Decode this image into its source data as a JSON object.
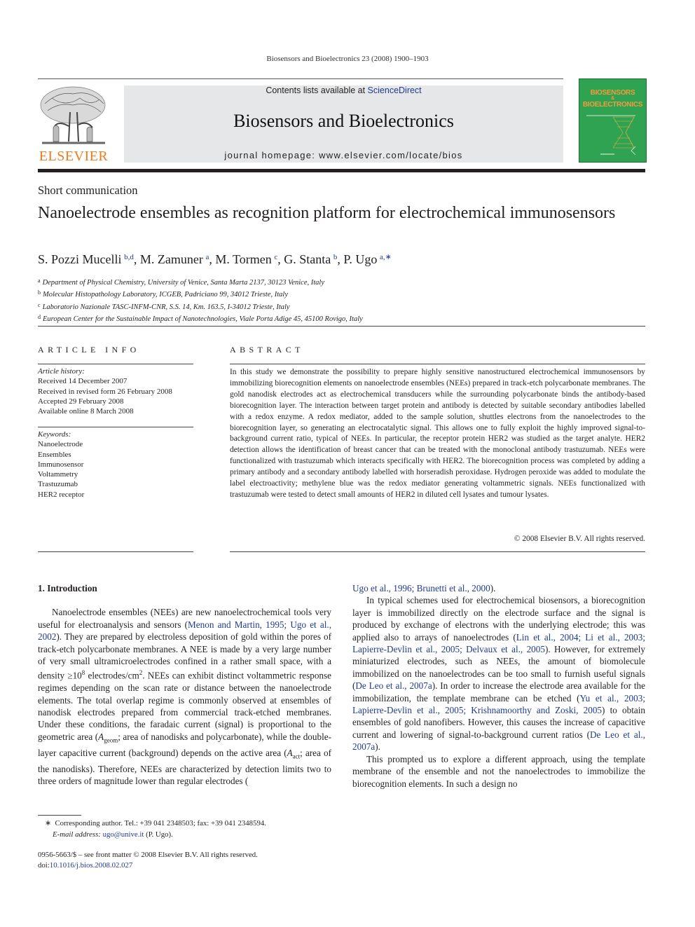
{
  "running_head": "Biosensors and Bioelectronics 23 (2008) 1900–1903",
  "masthead": {
    "contents_prefix": "Contents lists available at ",
    "contents_link": "ScienceDirect",
    "journal_name": "Biosensors and Bioelectronics",
    "homepage_label": "journal homepage: www.elsevier.com/locate/bios",
    "publisher_logo_text": "ELSEVIER",
    "cover_title_line1": "BIOSENSORS",
    "cover_title_amp": "&",
    "cover_title_line2": "BIOELECTRONICS",
    "colors": {
      "masthead_bg": "#e6e7e9",
      "elsevier_orange": "#f07a1d",
      "cover_green": "#2fa352",
      "link_blue": "#1f3b8f"
    }
  },
  "article": {
    "type": "Short communication",
    "title": "Nanoelectrode ensembles as recognition platform for electrochemical immunosensors",
    "authors": [
      {
        "name": "S. Pozzi Mucelli",
        "sup": "b,d",
        "sep": ", "
      },
      {
        "name": "M. Zamuner",
        "sup": "a",
        "sep": ", "
      },
      {
        "name": "M. Tormen",
        "sup": "c",
        "sep": ", "
      },
      {
        "name": "G. Stanta",
        "sup": "b",
        "sep": ", "
      },
      {
        "name": "P. Ugo",
        "sup": "a,∗",
        "sep": ""
      }
    ],
    "affiliations": [
      {
        "key": "a",
        "text": "Department of Physical Chemistry, University of Venice, Santa Marta 2137, 30123 Venice, Italy"
      },
      {
        "key": "b",
        "text": "Molecular Histopathology Laboratory, ICGEB, Padriciano 99, 34012 Trieste, Italy"
      },
      {
        "key": "c",
        "text": "Laboratorio Nazionale TASC-INFM-CNR, S.S. 14, Km. 163.5, I-34012 Trieste, Italy"
      },
      {
        "key": "d",
        "text": "European Center for the Sustainable Impact of Nanotechnologies, Viale Porta Adige 45, 45100 Rovigo, Italy"
      }
    ]
  },
  "article_info": {
    "heading": "ARTICLE INFO",
    "history_label": "Article history:",
    "history": [
      "Received 14 December 2007",
      "Received in revised form 26 February 2008",
      "Accepted 29 February 2008",
      "Available online 8 March 2008"
    ],
    "keywords_label": "Keywords:",
    "keywords": [
      "Nanoelectrode",
      "Ensembles",
      "Immunosensor",
      "Voltammetry",
      "Trastuzumab",
      "HER2 receptor"
    ]
  },
  "abstract": {
    "heading": "ABSTRACT",
    "text": "In this study we demonstrate the possibility to prepare highly sensitive nanostructured electrochemical immunosensors by immobilizing biorecognition elements on nanoelectrode ensembles (NEEs) prepared in track-etch polycarbonate membranes. The gold nanodisk electrodes act as electrochemical transducers while the surrounding polycarbonate binds the antibody-based biorecognition layer. The interaction between target protein and antibody is detected by suitable secondary antibodies labelled with a redox enzyme. A redox mediator, added to the sample solution, shuttles electrons from the nanoelectrodes to the biorecognition layer, so generating an electrocatalytic signal. This allows one to fully exploit the highly improved signal-to-background current ratio, typical of NEEs. In particular, the receptor protein HER2 was studied as the target analyte. HER2 detection allows the identification of breast cancer that can be treated with the monoclonal antibody trastuzumab. NEEs were functionalized with trastuzumab which interacts specifically with HER2. The biorecognition process was completed by adding a primary antibody and a secondary antibody labelled with horseradish peroxidase. Hydrogen peroxide was added to modulate the label electroactivity; methylene blue was the redox mediator generating voltammetric signals. NEEs functionalized with trastuzumab were tested to detect small amounts of HER2 in diluted cell lysates and tumour lysates.",
    "copyright": "© 2008 Elsevier B.V. All rights reserved."
  },
  "intro": {
    "heading": "1.  Introduction",
    "p1": {
      "t1": "Nanoelectrode ensembles (NEEs) are new nanoelectrochemical tools very useful for electroanalysis and sensors (",
      "l1": "Menon and Martin, 1995; Ugo et al., 2002",
      "t2": "). They are prepared by electroless deposition of gold within the pores of track-etch polycarbonate membranes. A NEE is made by a very large number of very small ultramicroelectrodes confined in a rather small space, with a density ≥10",
      "sup1": "8",
      "t3": " electrodes/cm",
      "sup2": "2",
      "t4": ". NEEs can exhibit distinct voltammetric response regimes depending on the scan rate or distance between the nanoelectrode elements. The total overlap regime is commonly observed at ensembles of nanodisk electrodes prepared from commercial track-etched membranes. Under these conditions, the faradaic current (signal) is proportional to the geometric area (",
      "a1": "A",
      "sub1": "geom",
      "t5": "; area of nanodisks and polycarbonate), while the double-layer capacitive current (background) depends on the active area (",
      "a2": "A",
      "sub2": "act",
      "t6": "; area of the nanodisks). Therefore, NEEs are characterized by detection limits two to three orders of magnitude lower than regular electrodes (",
      "l2": "Ugo et al., 1996; Brunetti et al., 2000",
      "t7": ")."
    },
    "p2": {
      "t1": "In typical schemes used for electrochemical biosensors, a biorecognition layer is immobilized directly on the electrode surface and the signal is produced by exchange of electrons with the underlying electrode; this was applied also to arrays of nanoelectrodes (",
      "l1": "Lin et al., 2004; Li et al., 2003; Lapierre-Devlin et al., 2005; Delvaux et al., 2005",
      "t2": "). However, for extremely miniaturized electrodes, such as NEEs, the amount of biomolecule immobilized on the nanoelectrodes can be too small to furnish useful signals (",
      "l2": "De Leo et al., 2007a",
      "t3": "). In order to increase the electrode area available for the immobilization, the template membrane can be etched (",
      "l3": "Yu et al., 2003; Lapierre-Devlin et al., 2005; Krishnamoorthy and Zoski, 2005",
      "t4": ") to obtain ensembles of gold nanofibers. However, this causes the increase of capacitive current and lowering of signal-to-background current ratios (",
      "l4": "De Leo et al., 2007a",
      "t5": ")."
    },
    "p3": "This prompted us to explore a different approach, using the template membrane of the ensemble and not the nanoelectrodes to immobilize the biorecognition elements. In such a design no"
  },
  "footnote": {
    "marker": "∗",
    "corresponding": "Corresponding author. Tel.: +39 041 2348503; fax: +39 041 2348594.",
    "email_label": "E-mail address:",
    "email": "ugo@unive.it",
    "email_suffix": " (P. Ugo)."
  },
  "front_matter": {
    "issn_line": "0956-5663/$ – see front matter © 2008 Elsevier B.V. All rights reserved.",
    "doi_prefix": "doi:",
    "doi": "10.1016/j.bios.2008.02.027"
  }
}
